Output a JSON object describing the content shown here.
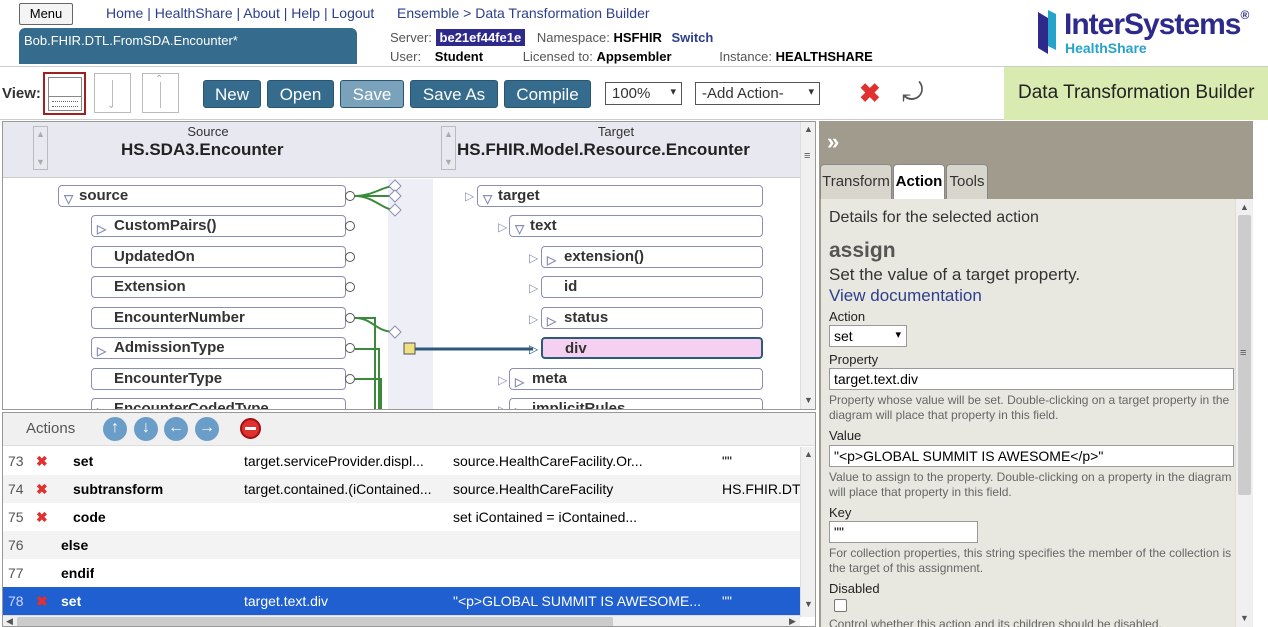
{
  "header": {
    "menu_label": "Menu",
    "nav_links": [
      "Home",
      "HealthShare",
      "About",
      "Help",
      "Logout"
    ],
    "breadcrumb": "Ensemble > Data Transformation Builder",
    "document_tab": "Bob.FHIR.DTL.FromSDA.Encounter*",
    "server_label": "Server:",
    "server_value": "be21ef44fe1e",
    "namespace_label": "Namespace:",
    "namespace_value": "HSFHIR",
    "switch_label": "Switch",
    "user_label": "User:",
    "user_value": "Student",
    "licensed_label": "Licensed to:",
    "licensed_value": "Appsembler",
    "instance_label": "Instance:",
    "instance_value": "HEALTHSHARE",
    "logo_text": "InterSystems",
    "logo_sub": "HealthShare"
  },
  "toolbar": {
    "view_label": "View:",
    "buttons": [
      "New",
      "Open",
      "Save",
      "Save As",
      "Compile"
    ],
    "zoom": "100%",
    "add_action": "-Add Action-",
    "title": "Data Transformation Builder"
  },
  "diagram": {
    "source_caption": "Source",
    "source_class": "HS.SDA3.Encounter",
    "target_caption": "Target",
    "target_class": "HS.FHIR.Model.Resource.Encounter",
    "source_nodes": [
      "source",
      "CustomPairs()",
      "UpdatedOn",
      "Extension",
      "EncounterNumber",
      "AdmissionType",
      "EncounterType",
      "EncounterCodedType"
    ],
    "target_nodes": [
      "target",
      "text",
      "extension()",
      "id",
      "status",
      "div",
      "meta",
      "implicitRules"
    ]
  },
  "actions": {
    "label": "Actions",
    "rows": [
      {
        "num": "73",
        "action": "set",
        "target": "target.serviceProvider.displ...",
        "source": "source.HealthCareFacility.Or...",
        "key": "\"\""
      },
      {
        "num": "74",
        "action": "subtransform",
        "target": "target.contained.(iContained...",
        "source": "source.HealthCareFacility",
        "key": "HS.FHIR.DT"
      },
      {
        "num": "75",
        "action": "code",
        "target": "",
        "source": "set iContained = iContained...",
        "key": ""
      },
      {
        "num": "76",
        "action": "else",
        "target": "",
        "source": "",
        "key": ""
      },
      {
        "num": "77",
        "action": "endif",
        "target": "",
        "source": "",
        "key": ""
      },
      {
        "num": "78",
        "action": "set",
        "target": "target.text.div",
        "source": "\"<p>GLOBAL SUMMIT IS AWESOME...",
        "key": "\"\""
      }
    ]
  },
  "panel": {
    "tabs": [
      "Transform",
      "Action",
      "Tools"
    ],
    "details_title": "Details for the selected action",
    "action_name": "assign",
    "action_desc": "Set the value of a target property.",
    "doc_link": "View documentation",
    "action_label": "Action",
    "action_value": "set",
    "property_label": "Property",
    "property_value": "target.text.div",
    "property_hint": "Property whose value will be set. Double-clicking on a target property in the diagram will place that property in this field.",
    "value_label": "Value",
    "value_value": "\"<p>GLOBAL SUMMIT IS AWESOME</p>\"",
    "value_hint": "Value to assign to the property. Double-clicking on a property in the diagram will place that property in this field.",
    "key_label": "Key",
    "key_value": "\"\"",
    "key_hint": "For collection properties, this string specifies the member of the collection is the target of this assignment.",
    "disabled_label": "Disabled",
    "disabled_hint": "Control whether this action and its children should be disabled."
  }
}
